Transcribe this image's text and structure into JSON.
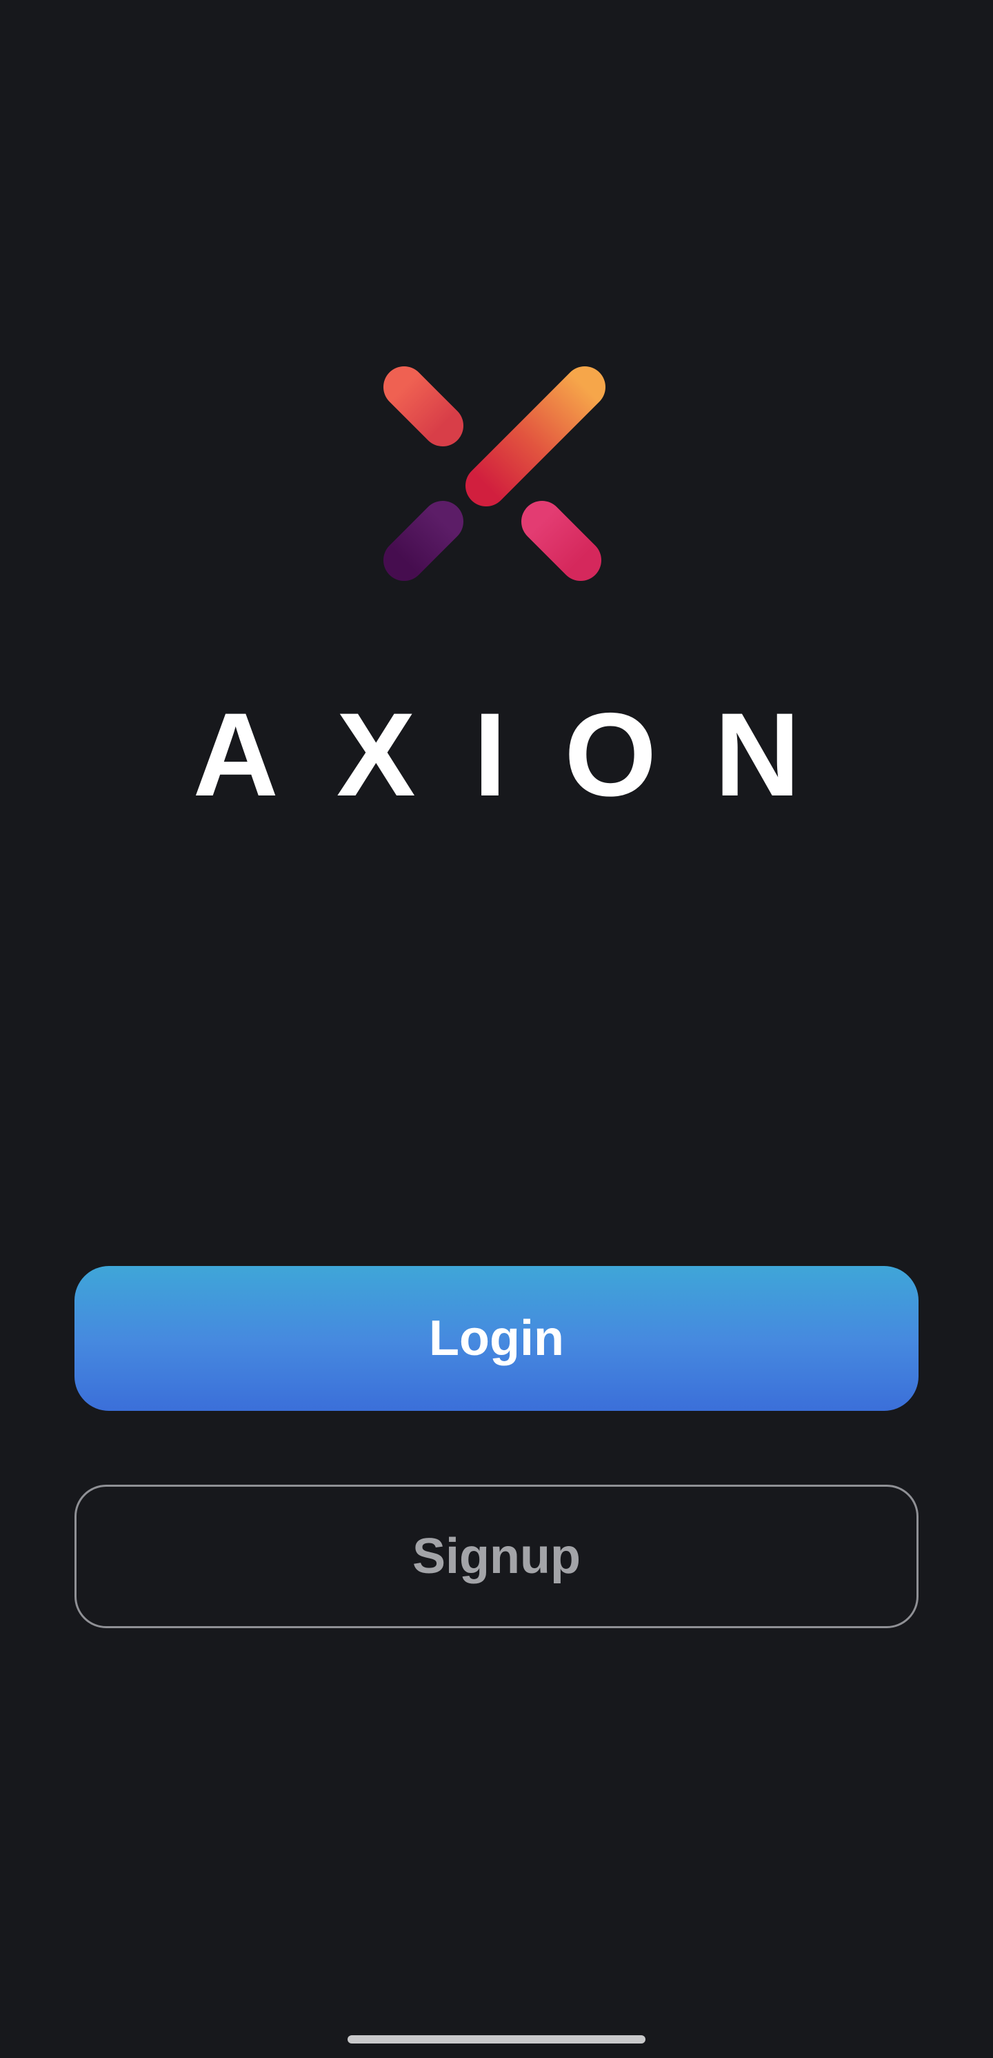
{
  "app": {
    "brand_name": "AXION",
    "logo_icon": "axion-x-logo-icon"
  },
  "actions": {
    "login_label": "Login",
    "signup_label": "Signup"
  },
  "colors": {
    "background": "#17181c",
    "login_top": "#3fa6d8",
    "login_bottom": "#3b6fd9",
    "signup_border": "#8f9095",
    "signup_text": "#a3a4a8",
    "logo_orange": "#f3a149",
    "logo_red": "#d7233f",
    "logo_coral": "#e95a4e",
    "logo_pink": "#dc336b",
    "logo_purple": "#4b1055"
  },
  "system": {
    "home_indicator": "home-indicator"
  }
}
